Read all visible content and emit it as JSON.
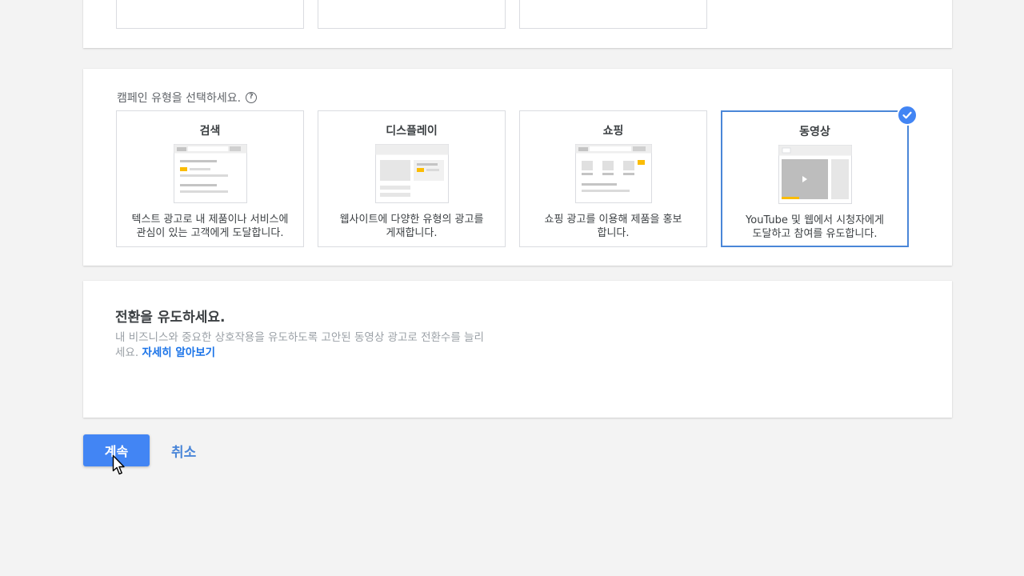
{
  "campaign_type": {
    "label": "캠페인 유형을 선택하세요.",
    "help_icon": "help-circle-icon",
    "tiles": [
      {
        "title": "검색",
        "desc_line1": "텍스트 광고로 내 제품이나 서비스에",
        "desc_line2": "관심이 있는 고객에게 도달합니다.",
        "selected": false
      },
      {
        "title": "디스플레이",
        "desc_line1": "웹사이트에 다양한 유형의 광고를",
        "desc_line2": "게재합니다.",
        "selected": false
      },
      {
        "title": "쇼핑",
        "desc_line1": "쇼핑 광고를 이용해 제품을 홍보",
        "desc_line2": "합니다.",
        "selected": false
      },
      {
        "title": "동영상",
        "desc_line1": "YouTube 및 웹에서 시청자에게",
        "desc_line2": "도달하고 참여를 유도합니다.",
        "selected": true
      }
    ]
  },
  "goal": {
    "title": "전환을 유도하세요.",
    "desc": "내 비즈니스와 중요한 상호작용을 유도하도록 고안된 동영상 광고로 전환수를 늘리세요.",
    "link": "자세히 알아보기"
  },
  "actions": {
    "continue_label": "계속",
    "cancel_label": "취소"
  },
  "colors": {
    "accent": "#4285f4",
    "selected_border": "#4a86d8",
    "highlight": "#fbbc04"
  }
}
